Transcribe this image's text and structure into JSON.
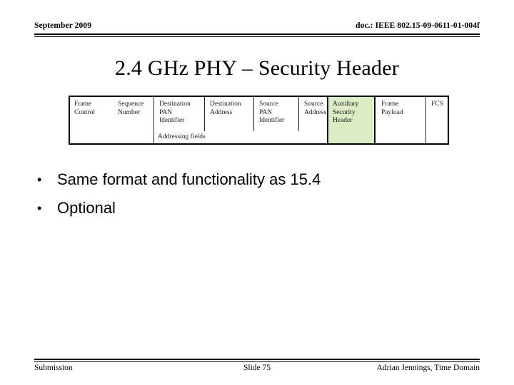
{
  "header": {
    "date": "September 2009",
    "doc_id": "doc.: IEEE 802.15-09-0611-01-004f"
  },
  "title": "2.4 GHz PHY – Security Header",
  "figure": {
    "name": "ieee-802-15-4-frame-format",
    "addressing_label": "Addressing fields",
    "highlight_color": "#dcecc4",
    "border_color": "#000000",
    "cells": [
      {
        "id": "frame-control",
        "label_line1": "Frame",
        "label_line2": "Control",
        "label_line3": ""
      },
      {
        "id": "sequence-number",
        "label_line1": "Sequence",
        "label_line2": "Number",
        "label_line3": ""
      },
      {
        "id": "destination-pan-identifier",
        "label_line1": "Destination",
        "label_line2": "PAN",
        "label_line3": "Identifier"
      },
      {
        "id": "destination-address",
        "label_line1": "Destination",
        "label_line2": "Address",
        "label_line3": ""
      },
      {
        "id": "source-pan-identifier",
        "label_line1": "Source",
        "label_line2": "PAN",
        "label_line3": "Identifier"
      },
      {
        "id": "source-address",
        "label_line1": "Source",
        "label_line2": "Address",
        "label_line3": ""
      },
      {
        "id": "auxiliary-security-header",
        "label_line1": "Auxiliary",
        "label_line2": "Security",
        "label_line3": "Header"
      },
      {
        "id": "frame-payload",
        "label_line1": "Frame",
        "label_line2": "Payload",
        "label_line3": ""
      },
      {
        "id": "fcs",
        "label_line1": "FCS",
        "label_line2": "",
        "label_line3": ""
      }
    ]
  },
  "bullets": [
    {
      "marker": "•",
      "text": "Same format and functionality as 15.4"
    },
    {
      "marker": "•",
      "text": "Optional"
    }
  ],
  "footer": {
    "left": "Submission",
    "center": "Slide 75",
    "right": "Adrian Jennings, Time Domain"
  }
}
